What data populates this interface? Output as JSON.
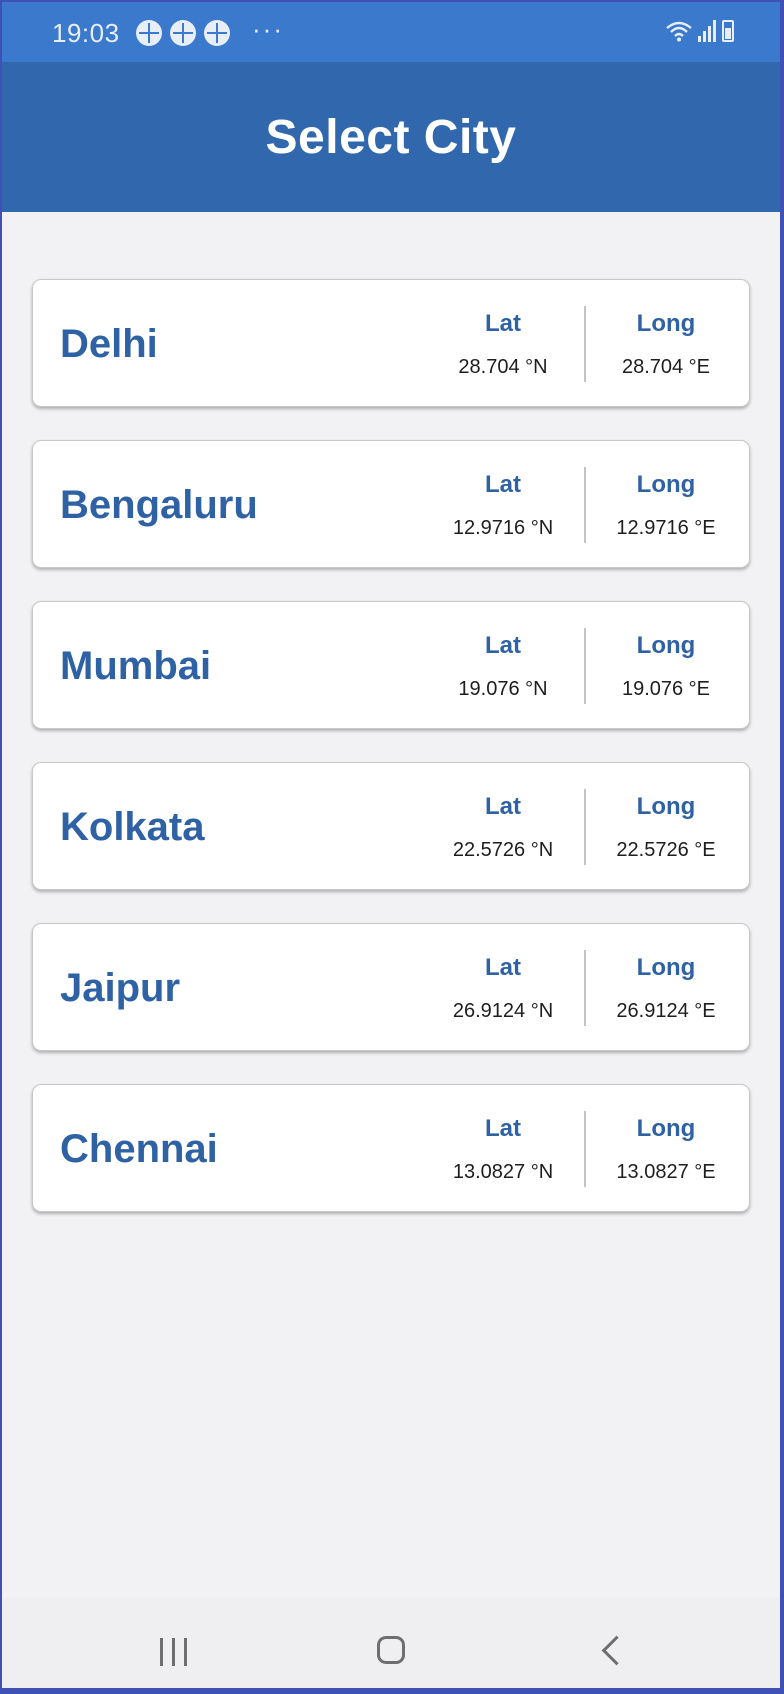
{
  "status_bar": {
    "time": "19:03",
    "more_indicator": "···",
    "notification_icons": [
      "app-notification-icon",
      "app-notification-icon",
      "app-notification-icon"
    ],
    "right_icons": [
      "wifi-icon",
      "signal-icon",
      "battery-icon"
    ]
  },
  "app_bar": {
    "title": "Select City"
  },
  "cities": [
    {
      "name": "Delhi",
      "lat_label": "Lat",
      "lat_value": "28.704 °N",
      "long_label": "Long",
      "long_value": "28.704 °E"
    },
    {
      "name": "Bengaluru",
      "lat_label": "Lat",
      "lat_value": "12.9716 °N",
      "long_label": "Long",
      "long_value": "12.9716 °E"
    },
    {
      "name": "Mumbai",
      "lat_label": "Lat",
      "lat_value": "19.076 °N",
      "long_label": "Long",
      "long_value": "19.076 °E"
    },
    {
      "name": "Kolkata",
      "lat_label": "Lat",
      "lat_value": "22.5726 °N",
      "long_label": "Long",
      "long_value": "22.5726 °E"
    },
    {
      "name": "Jaipur",
      "lat_label": "Lat",
      "lat_value": "26.9124 °N",
      "long_label": "Long",
      "long_value": "26.9124 °E"
    },
    {
      "name": "Chennai",
      "lat_label": "Lat",
      "lat_value": "13.0827 °N",
      "long_label": "Long",
      "long_value": "13.0827 °E"
    }
  ],
  "nav_bar": {
    "buttons": [
      "recents-icon",
      "home-icon",
      "back-icon"
    ]
  },
  "colors": {
    "status_bar": "#3a79cc",
    "app_bar": "#3167ad",
    "accent_text": "#2f62a4",
    "background": "#f2f2f4",
    "card": "#ffffff"
  }
}
